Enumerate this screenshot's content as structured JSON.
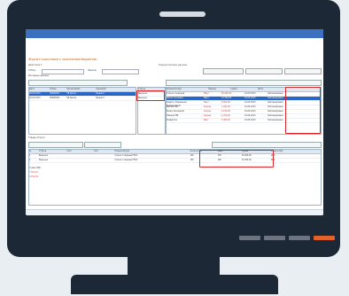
{
  "app": {
    "title": "Журнал подготовки к заполнению бюджетов",
    "menu_left": "Действия ▾",
    "menu_right": "Корректировка данных"
  },
  "colors": {
    "monitor": "#1c2836",
    "title_bar": "#3b6fbf",
    "selected_row": "#2a66c8",
    "highlight": "#d6262a",
    "accent_button": "#e3612a"
  },
  "left_table": {
    "headers": [
      "Дата",
      "Номер",
      "Организация",
      "Сценарий"
    ],
    "rows": [
      [
        "20.03.2013",
        "00000001",
        "ТД Орион",
        "Бюджет"
      ],
      [
        "20.03.2013",
        "00000002",
        "ТД Орион",
        "Бюджет"
      ]
    ]
  },
  "highlight_col": {
    "header": "Статья",
    "rows": [
      "Выручка",
      "Выручка"
    ]
  },
  "right_table": {
    "headers": [
      "Номенклатура",
      "Период",
      "Сумма",
      "Дата",
      "Комментарий"
    ],
    "rows": [
      [
        "Станок токарный",
        "Март",
        "50 000,00",
        "01.03.2013",
        "Запланировано"
      ],
      [
        "Фреза концевая",
        "Март",
        "12 000,00",
        "01.03.2013",
        "Запланировано"
      ],
      [
        "Сверло спиральное",
        "Март",
        "8 500,00",
        "01.03.2013",
        "Запланировано"
      ],
      [
        "Метчик М6",
        "Апрель",
        "3 200,00",
        "01.04.2013",
        "Запланировано"
      ],
      [
        "Резец проходной",
        "Апрель",
        "4 100,00",
        "01.04.2013",
        "Запланировано"
      ],
      [
        "Плашка М8",
        "Апрель",
        "2 700,00",
        "01.04.2013",
        "Запланировано"
      ],
      [
        "Развертка",
        "Май",
        "5 900,00",
        "01.05.2013",
        "Запланировано"
      ]
    ]
  },
  "bottom_table": {
    "headers": [
      "№",
      "Статья",
      "Счет",
      "Кол.",
      "Номенклатура",
      "Количество",
      "Цена",
      "Сумма",
      "Ставка НДС",
      "Сумма НДС"
    ],
    "rows": [
      [
        "1",
        "Выручка",
        "",
        "",
        "Станок токарный ТВ-4",
        "100",
        "500",
        "50 000,00",
        "18%",
        "7 627,12"
      ],
      [
        "2",
        "Выручка",
        "",
        "",
        "Станок токарный ТВ-6",
        "100",
        "600",
        "60 000,00",
        "18%",
        "9 152,54"
      ]
    ]
  },
  "labels": {
    "filter": "Отбор:",
    "period": "Период:",
    "section": "Исходные данные",
    "tabs": "Товары  Услуги"
  }
}
